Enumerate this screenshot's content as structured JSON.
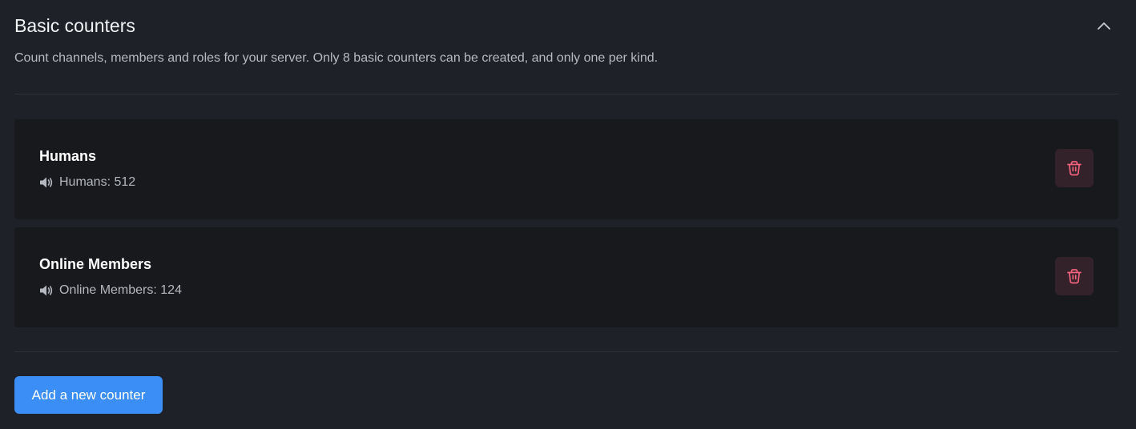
{
  "section": {
    "title": "Basic counters",
    "description": "Count channels, members and roles for your server. Only 8 basic counters can be created, and only one per kind.",
    "collapse_icon": "chevron-up-icon"
  },
  "counters": [
    {
      "name": "Humans",
      "channel_label": "Humans: 512",
      "channel_icon": "speaker-icon",
      "delete_icon": "trash-icon"
    },
    {
      "name": "Online Members",
      "channel_label": "Online Members: 124",
      "channel_icon": "speaker-icon",
      "delete_icon": "trash-icon"
    }
  ],
  "actions": {
    "add_label": "Add a new counter"
  },
  "colors": {
    "background": "#1f2128",
    "card": "#18191d",
    "accent": "#3b8ef5",
    "danger": "#f2637e",
    "danger_bg": "#34222a"
  }
}
